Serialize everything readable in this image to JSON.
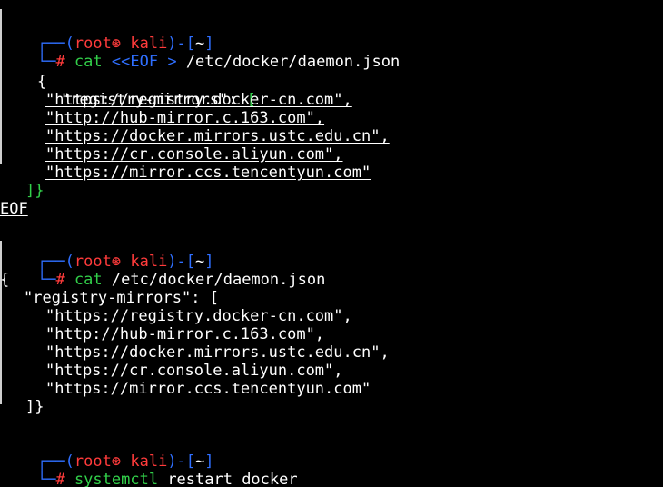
{
  "prompt": {
    "open": "┌──(",
    "user": "root",
    "skull": "⊛",
    "host": "kali",
    "mid": ")-[",
    "dir": "~",
    "close": "]",
    "second": "└─",
    "hash": "#"
  },
  "block1": {
    "command_name": "cat",
    "command_args": "<<EOF >",
    "command_path": "/etc/docker/daemon.json",
    "open_brace": "{",
    "key_line": "\"registry-mirrors\": [",
    "key_text": "\"registry-mirrors\":",
    "key_bracket": "[",
    "mirrors": [
      "\"https://registry.docker-cn.com\",",
      "\"http://hub-mirror.c.163.com\",",
      "\"https://docker.mirrors.ustc.edu.cn\",",
      "\"https://cr.console.aliyun.com\",",
      "\"https://mirror.ccs.tencentyun.com\""
    ],
    "close_line": "]}",
    "eof": "EOF"
  },
  "block2": {
    "command_name": "cat",
    "command_path": "/etc/docker/daemon.json",
    "open_brace": "{",
    "key_line": "\"registry-mirrors\": [",
    "mirrors": [
      "\"https://registry.docker-cn.com\",",
      "\"http://hub-mirror.c.163.com\",",
      "\"https://docker.mirrors.ustc.edu.cn\",",
      "\"https://cr.console.aliyun.com\",",
      "\"https://mirror.ccs.tencentyun.com\""
    ],
    "close_line": "]}"
  },
  "block3": {
    "command_name": "systemctl",
    "command_args": "restart docker"
  },
  "colors": {
    "background": "#000000",
    "prompt_frame": "#2f6fff",
    "prompt_user": "#ff3b3b",
    "command": "#32d04a",
    "text": "#ffffff"
  }
}
